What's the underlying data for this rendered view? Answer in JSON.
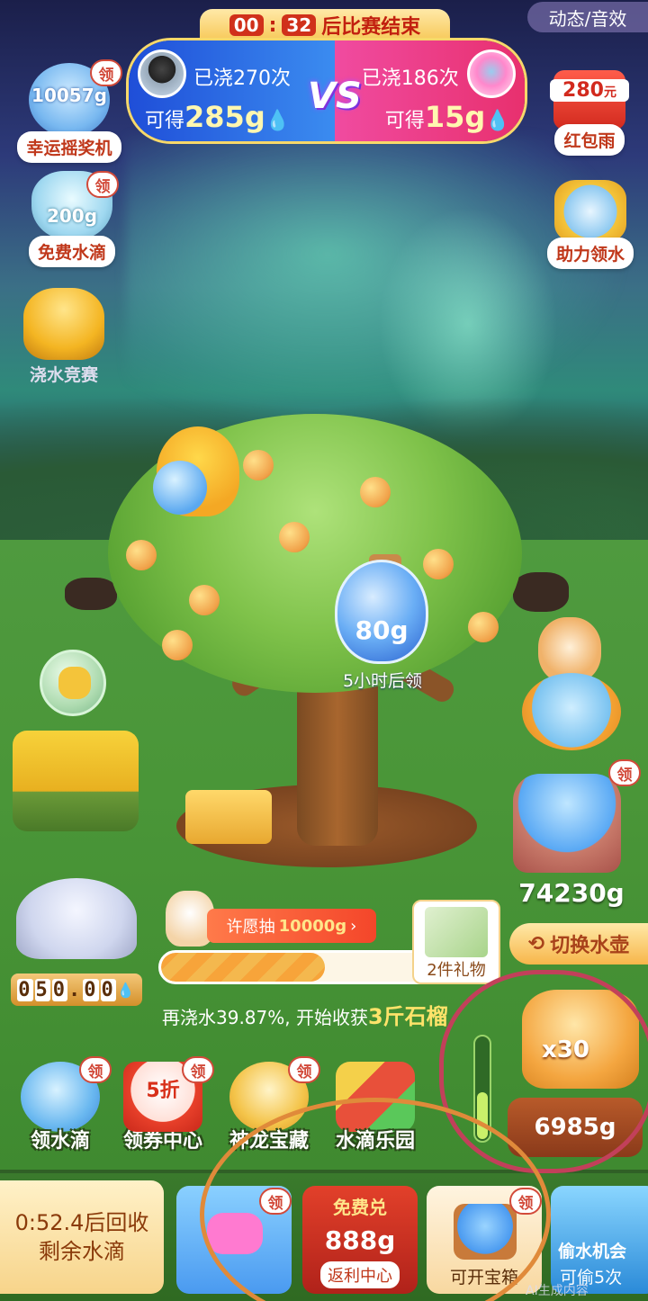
{
  "match": {
    "countdown_min": "00",
    "countdown_sec": "32",
    "countdown_suffix": "后比赛结束",
    "left_count": "已浇270次",
    "left_gain_prefix": "可得",
    "left_gain": "285g",
    "right_count": "已浇186次",
    "right_gain_prefix": "可得",
    "right_gain": "15g",
    "vs": "VS"
  },
  "top_right_toggle": "动态/音效",
  "left_side": {
    "lottery_amount": "10057g",
    "lottery_label": "幸运摇奖机",
    "free_amount": "200g",
    "free_label": "免费水滴",
    "contest_label": "浇水竞赛"
  },
  "right_side": {
    "redpack_amount": "280",
    "redpack_unit": "元",
    "redpack_label": "红包雨",
    "assist_label": "助力领水"
  },
  "badge": "领",
  "tree": {
    "bottle_amount": "80g",
    "bottle_caption": "5小时后领"
  },
  "fountain_digits": [
    "0",
    "5",
    "0",
    "0",
    "0"
  ],
  "fountain_dot": ".",
  "cart_amount": "74230g",
  "switch_label": "切换水壶",
  "wish": {
    "prefix": "许愿抽",
    "amount": "10000g"
  },
  "gift_label": "2件礼物",
  "progress_fraction": 0.49,
  "harvest": {
    "prefix": "再浇水39.87%, 开始收获",
    "highlight": "3斤石榴"
  },
  "kettle": {
    "multiplier": "x30",
    "amount": "6985g",
    "level_fraction": 0.45
  },
  "features": [
    {
      "label": "领水滴"
    },
    {
      "label": "领券中心",
      "tag": "5折"
    },
    {
      "label": "神龙宝藏"
    },
    {
      "label": "水滴乐园"
    }
  ],
  "dock": {
    "timer_line1": "0:52.4后回收",
    "timer_line2": "剩余水滴",
    "exchange_top": "免费兑",
    "exchange_amount": "888g",
    "exchange_label": "返利中心",
    "chest_label": "可开宝箱",
    "steal_top": "偷水机会",
    "steal_label": "可偷5次"
  },
  "ai_mark": "AI生成内容",
  "colors": {
    "accent_red": "#d24a3a",
    "annotation_red": "#c2405a",
    "annotation_orange": "#e08a3a"
  }
}
